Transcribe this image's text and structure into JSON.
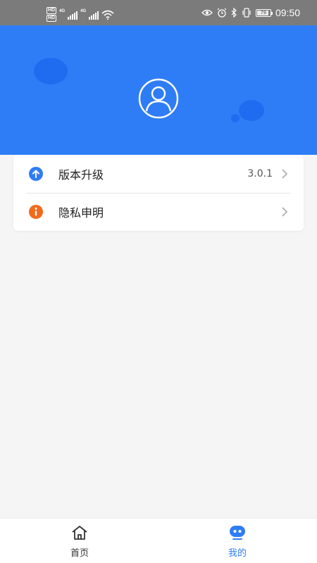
{
  "status_bar": {
    "hd_badge_1": "HD",
    "hd_badge_2": "HD",
    "sim1_tag": "4G",
    "sim2_tag": "4G",
    "battery_level": "79",
    "time": "09:50"
  },
  "menu": {
    "items": [
      {
        "label": "版本升级",
        "value": "3.0.1",
        "icon": "upgrade-arrow-icon",
        "icon_color": "#2f7df6"
      },
      {
        "label": "隐私申明",
        "icon": "info-icon",
        "icon_color": "#f26b1d"
      }
    ]
  },
  "tabbar": {
    "tabs": [
      {
        "label": "首页",
        "icon": "home-icon",
        "active": false
      },
      {
        "label": "我的",
        "icon": "mine-icon",
        "active": true
      }
    ]
  },
  "colors": {
    "accent": "#2f7df6",
    "header_bg": "#2f7df6",
    "page_bg": "#f5f5f5",
    "status_bar_bg": "#7b7b7b",
    "info_orange": "#f26b1d"
  }
}
